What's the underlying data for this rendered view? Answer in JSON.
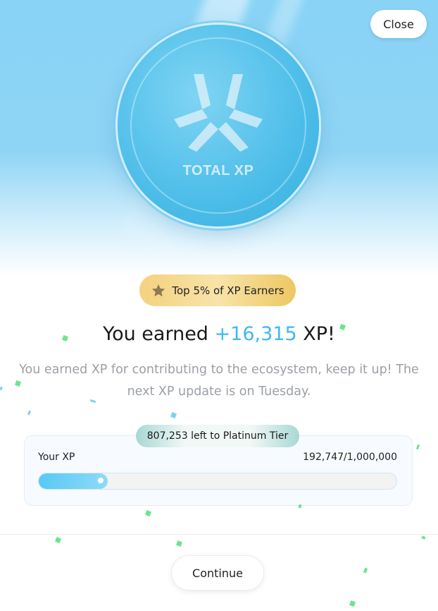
{
  "header": {
    "close_label": "Close"
  },
  "coin": {
    "label": "TOTAL XP",
    "icon": "xp-logo-icon"
  },
  "badge": {
    "label": "Top 5% of XP Earners",
    "icon": "star-icon"
  },
  "headline": {
    "prefix": "You earned ",
    "amount": "+16,315",
    "suffix": " XP!"
  },
  "subtitle": "You earned XP for contributing to the ecosystem, keep it up! The next XP update is on Tuesday.",
  "progress": {
    "tier_text": "807,253 left to Platinum Tier",
    "label": "Your XP",
    "value_text": "192,747/1,000,000",
    "fraction": 0.192747
  },
  "footer": {
    "continue_label": "Continue"
  },
  "colors": {
    "accent": "#3fb8f0",
    "badge_gold": "#f4d27f",
    "confetti_green": "#6ee38f",
    "confetti_blue": "#7fd0f5"
  }
}
